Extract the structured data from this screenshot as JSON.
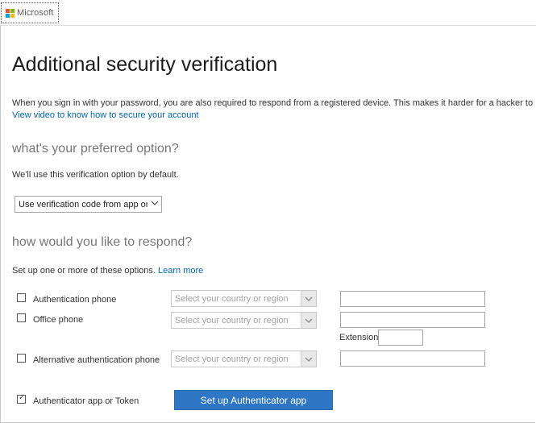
{
  "header": {
    "logo_text": "Microsoft",
    "logo_colors": [
      "#f25022",
      "#7fba00",
      "#00a4ef",
      "#ffb900"
    ]
  },
  "page": {
    "title": "Additional security verification",
    "intro_text": "When you sign in with your password, you are also required to respond from a registered device. This makes it harder for a hacker to",
    "intro_link": "View video to know how to secure your account"
  },
  "preferred": {
    "heading": "what's your preferred option?",
    "description": "We'll use this verification option by default.",
    "selected_option": "Use verification code from app or token"
  },
  "respond": {
    "heading": "how would you like to respond?",
    "description": "Set up one or more of these options.",
    "learn_more": "Learn more",
    "country_placeholder": "Select your country or region",
    "extension_label": "Extension",
    "options": [
      {
        "label": "Authentication phone",
        "checked": false
      },
      {
        "label": "Office phone",
        "checked": false
      },
      {
        "label": "Alternative authentication phone",
        "checked": false
      },
      {
        "label": "Authenticator app or Token",
        "checked": true
      }
    ],
    "setup_button": "Set up Authenticator app"
  },
  "colors": {
    "accent": "#2f77c4",
    "link": "#0067b8",
    "muted_heading": "#767676"
  }
}
